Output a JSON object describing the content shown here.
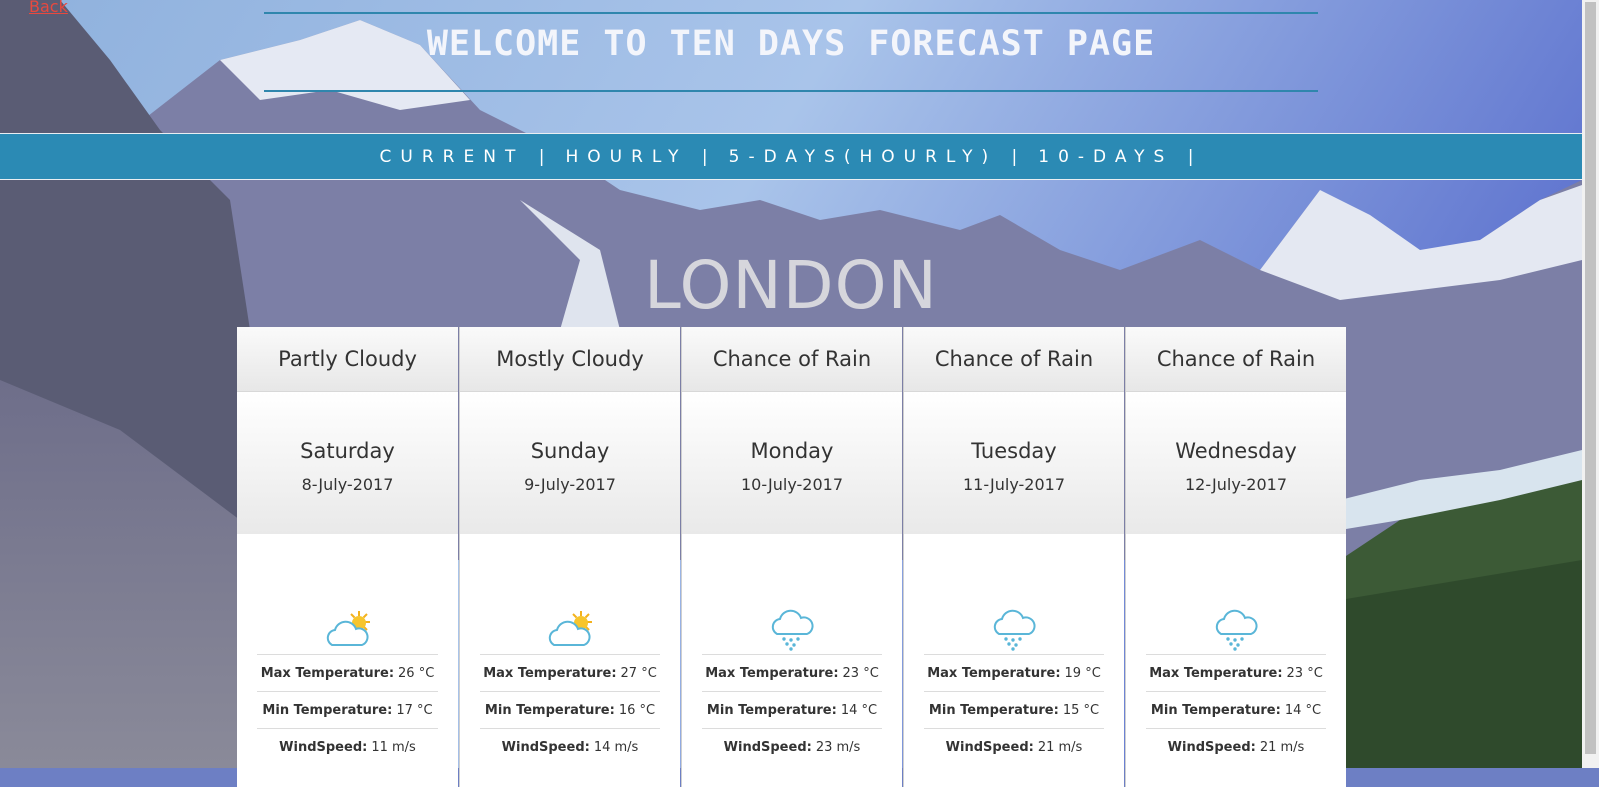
{
  "nav": {
    "back_label": "Back"
  },
  "header": {
    "title": "WELCOME TO TEN DAYS FORECAST PAGE"
  },
  "menu": {
    "items": [
      {
        "label": "CURRENT |"
      },
      {
        "label": "HOURLY |"
      },
      {
        "label": "5-DAYS(HOURLY) |"
      },
      {
        "label": "10-DAYS |"
      }
    ]
  },
  "city": "LONDON",
  "labels": {
    "max": "Max Temperature:",
    "min": "Min Temperature:",
    "wind": "WindSpeed:"
  },
  "forecast": [
    {
      "condition": "Partly Cloudy",
      "day": "Saturday",
      "date": "8-July-2017",
      "icon": "partly-cloudy-icon",
      "max": "26 °C",
      "min": "17 °C",
      "wind": "11 m/s"
    },
    {
      "condition": "Mostly Cloudy",
      "day": "Sunday",
      "date": "9-July-2017",
      "icon": "partly-cloudy-icon",
      "max": "27 °C",
      "min": "16 °C",
      "wind": "14 m/s"
    },
    {
      "condition": "Chance of Rain",
      "day": "Monday",
      "date": "10-July-2017",
      "icon": "rain-cloud-icon",
      "max": "23 °C",
      "min": "14 °C",
      "wind": "23 m/s"
    },
    {
      "condition": "Chance of Rain",
      "day": "Tuesday",
      "date": "11-July-2017",
      "icon": "rain-cloud-icon",
      "max": "19 °C",
      "min": "15 °C",
      "wind": "21 m/s"
    },
    {
      "condition": "Chance of Rain",
      "day": "Wednesday",
      "date": "12-July-2017",
      "icon": "rain-cloud-icon",
      "max": "23 °C",
      "min": "14 °C",
      "wind": "21 m/s"
    }
  ],
  "colors": {
    "navbar": "#2b8ab4",
    "back_link": "#e8493f"
  }
}
